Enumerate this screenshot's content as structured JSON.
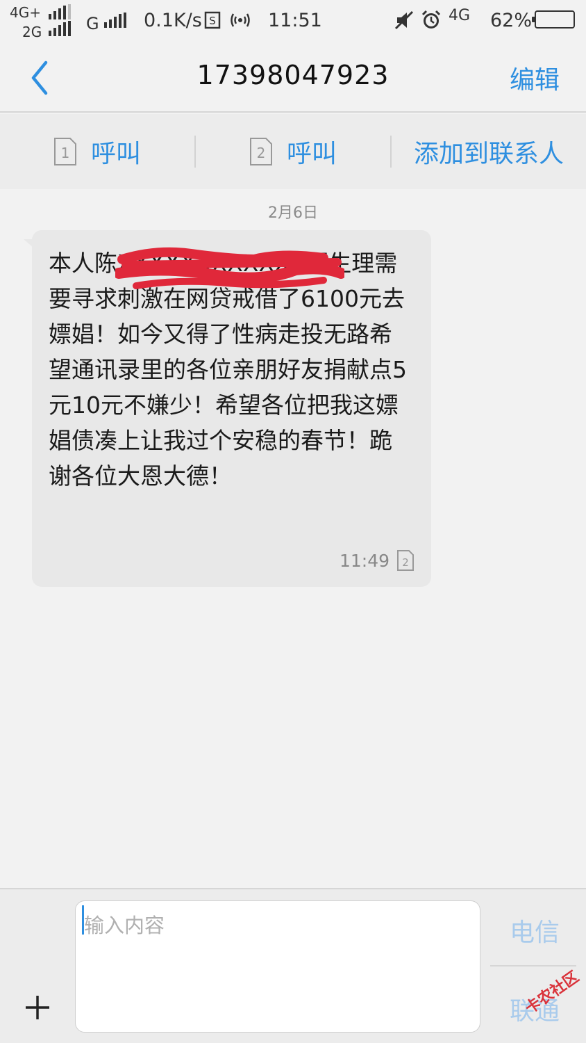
{
  "status_bar": {
    "net1": "4G+",
    "net2": "2G",
    "net3": "G",
    "speed": "0.1K/s",
    "time": "11:51",
    "net4": "4G",
    "battery": "62%",
    "battery_level": 0.62
  },
  "header": {
    "title": "17398047923",
    "edit_label": "编辑"
  },
  "actions": {
    "call_sim1": "呼叫",
    "call_sim2": "呼叫",
    "add_contact": "添加到联系人",
    "sim1": "1",
    "sim2": "2"
  },
  "conversation": {
    "date": "2月6日",
    "message": {
      "text": "本人陈XXXXXXXXXXXX因生理需要寻求刺激在网贷戒借了6100元去嫖娼！如今又得了性病走投无路希望通讯录里的各位亲朋好友捐献点5元10元不嫌少！希望各位把我这嫖娼债凑上让我过个安稳的春节！跪谢各位大恩大德！",
      "time": "11:49",
      "sim": "2"
    }
  },
  "compose": {
    "placeholder": "输入内容",
    "carrier1": "电信",
    "carrier2": "联通"
  },
  "watermark": "卡农社区",
  "colors": {
    "accent": "#2e8fe0",
    "bubble": "#e8e8e8",
    "redaction": "#e0283a"
  }
}
